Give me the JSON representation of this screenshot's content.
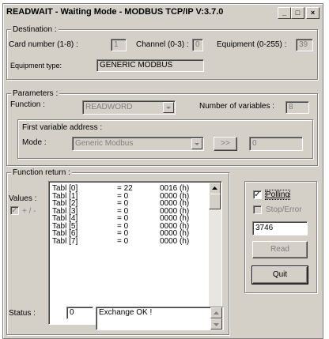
{
  "window": {
    "title": "READWAIT - Waiting Mode - MODBUS TCP/IP  V:3.7.0",
    "minimize_glyph": "_",
    "maximize_glyph": "□",
    "close_glyph": "×"
  },
  "destination": {
    "legend": "Destination :",
    "card_label": "Card number (1-8) :",
    "card_value": "1",
    "channel_label": "Channel (0-3) :",
    "channel_value": "0",
    "equipment_label": "Equipment (0-255) :",
    "equipment_value": "39",
    "type_label": "Equipment type:",
    "type_value": "GENERIC MODBUS"
  },
  "parameters": {
    "legend": "Parameters :",
    "function_label": "Function :",
    "function_value": "READWORD",
    "nvars_label": "Number of variables :",
    "nvars_value": "8",
    "first_addr_legend": "First variable address :",
    "mode_label": "Mode :",
    "mode_value": "Generic Modbus",
    "go_label": ">>",
    "addr_value": "0"
  },
  "function_return": {
    "legend": "Function return :",
    "values_label": "Values :",
    "plusminus_label": "+ / -",
    "checkmark": "✓",
    "rows": [
      {
        "name": "Tabl [0]",
        "eq": "= 22",
        "hex": "0016  (h)"
      },
      {
        "name": "Tabl [1]",
        "eq": "= 0",
        "hex": "0000  (h)"
      },
      {
        "name": "Tabl [2]",
        "eq": "= 0",
        "hex": "0000  (h)"
      },
      {
        "name": "Tabl [3]",
        "eq": "= 0",
        "hex": "0000  (h)"
      },
      {
        "name": "Tabl [4]",
        "eq": "= 0",
        "hex": "0000  (h)"
      },
      {
        "name": "Tabl [5]",
        "eq": "= 0",
        "hex": "0000  (h)"
      },
      {
        "name": "Tabl [6]",
        "eq": "= 0",
        "hex": "0000  (h)"
      },
      {
        "name": "Tabl [7]",
        "eq": "= 0",
        "hex": "0000  (h)"
      }
    ],
    "status_label": "Status :",
    "status_code": "0",
    "status_message": "Exchange OK !"
  },
  "side": {
    "polling_label": "Polling",
    "stop_error_label": "Stop/Error",
    "counter_value": "3746",
    "read_label": "Read",
    "quit_label": "Quit"
  },
  "colors": {
    "face": "#d4d0c8",
    "shadow": "#808080",
    "disabled_text": "#808080"
  }
}
